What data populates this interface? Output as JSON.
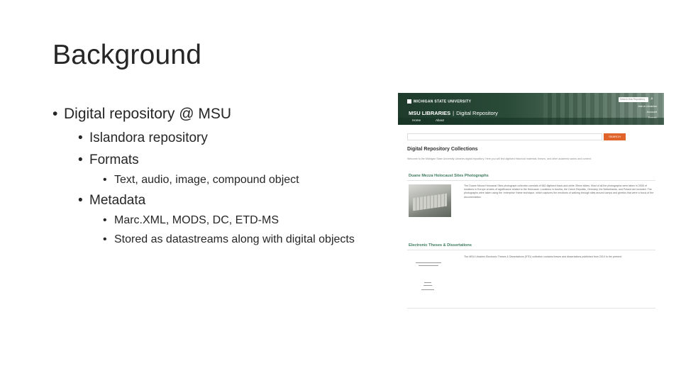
{
  "slide": {
    "title": "Background",
    "bullets": [
      {
        "text": "Digital repository @ MSU",
        "level": 1
      },
      {
        "text": "Islandora repository",
        "level": 2
      },
      {
        "text": "Formats",
        "level": 2
      },
      {
        "text": "Text, audio, image, compound object",
        "level": 3
      },
      {
        "text": "Metadata",
        "level": 2
      },
      {
        "text": "Marc.XML, MODS, DC, ETD-MS",
        "level": 3
      },
      {
        "text": "Stored as datastreams along with digital objects",
        "level": 3
      }
    ],
    "bullet_glyph": "•"
  },
  "screenshot": {
    "university": "MICHIGAN STATE UNIVERSITY",
    "libraries": "MSU LIBRARIES",
    "separator": "|",
    "site_name": "Digital Repository",
    "header_search_placeholder": "Search this Repository",
    "header_links": [
      "Ask a Librarian",
      "Account",
      "Events"
    ],
    "nav": [
      "Home",
      "About"
    ],
    "search_button": "SEARCH",
    "collections_title": "Digital Repository Collections",
    "intro_text": "Welcome to the Michigan State University Libraries digital repository. Here you will find digitized historical materials, theses, and other academic works and content.",
    "collections": [
      {
        "title": "Duane Mezza Holocaust Sites Photographs",
        "description": "The Duane Mezza Holocaust Sites photograph collection consists of 682 digitized black-and-white 35mm slides. Most of all the photographs were taken in 2005 of locations in Europe at sites of significance related to the Holocaust. Locations in Austria, the Czech Republic, Germany, the Netherlands, and Poland are included. The photographs were taken using the 'enterprise' frame technique, which captures the emotions of walking through sites around camps and ghettos that were a focus of the documentation."
      },
      {
        "title": "Electronic Theses & Dissertations",
        "description": "The MSU Libraries Electronic Theses & Dissertations (ETD) collection contains theses and dissertations published from 2010 to the present."
      }
    ]
  },
  "colors": {
    "header_green": "#1e3b2c",
    "link_green": "#3b7a5c",
    "search_button": "#e0642a"
  }
}
